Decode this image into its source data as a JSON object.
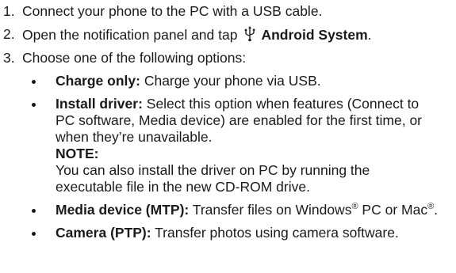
{
  "steps": [
    {
      "num": "1.",
      "text": "Connect your phone to the PC with a USB cable."
    },
    {
      "num": "2.",
      "text_before": "Open the notification panel and tap",
      "icon": "usb-icon",
      "bold": "Android System",
      "text_after": "."
    },
    {
      "num": "3.",
      "text": "Choose one of the following options:"
    }
  ],
  "options": [
    {
      "term": "Charge only:",
      "desc": " Charge your phone via USB."
    },
    {
      "term": "Install driver:",
      "desc": " Select this option when features (Connect to PC software, Media device) are enabled for the first time, or when they’re unavailable.",
      "note_label": "NOTE:",
      "note_text": "You can also install the driver on PC by running the executable file in the new CD-ROM drive."
    },
    {
      "term": "Media device (MTP):",
      "desc_a": " Transfer files on Windows",
      "sup1": "®",
      "desc_b": " PC or Mac",
      "sup2": "®",
      "desc_c": "."
    },
    {
      "term": "Camera (PTP):",
      "desc": " Transfer photos using camera software."
    }
  ]
}
